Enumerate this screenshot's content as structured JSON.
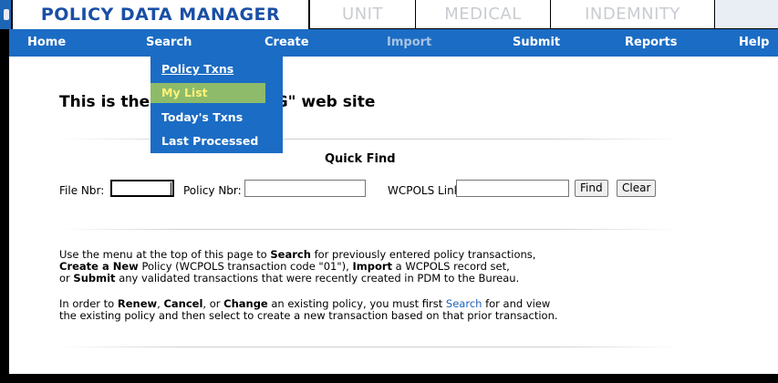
{
  "tabs": {
    "active": "POLICY DATA MANAGER",
    "unit": "UNIT",
    "medical": "MEDICAL",
    "indemnity": "INDEMNITY"
  },
  "menu": {
    "home": "Home",
    "search": "Search",
    "create": "Create",
    "import": "Import",
    "submit": "Submit",
    "reports": "Reports",
    "help": "Help"
  },
  "search_dropdown": {
    "items": [
      "Policy Txns",
      "My List",
      "Today's Txns",
      "Last Processed"
    ],
    "hovered": "My List"
  },
  "heading": {
    "visible_left": "This is the",
    "visible_right": "GING\" web site"
  },
  "quick_find": {
    "title": "Quick Find",
    "file_label": "File Nbr:",
    "policy_label": "Policy Nbr:",
    "wcpols_label": "WCPOLS Link:",
    "file_value": "",
    "policy_value": "",
    "wcpols_value": "",
    "find_button": "Find",
    "clear_button": "Clear"
  },
  "instructions": {
    "p1_line1_a": "Use the menu at the top of this page to ",
    "p1_line1_b": "Search",
    "p1_line1_c": " for previously entered policy transactions,",
    "p1_line2_a": "Create a New",
    "p1_line2_b": " Policy (WCPOLS transaction code \"01\"), ",
    "p1_line2_c": "Import",
    "p1_line2_d": " a WCPOLS record set,",
    "p1_line3_a": "or ",
    "p1_line3_b": "Submit",
    "p1_line3_c": " any validated transactions that were recently created in PDM to the Bureau.",
    "p2_line1_a": "In order to ",
    "p2_line1_b": "Renew",
    "p2_line1_c": ", ",
    "p2_line1_d": "Cancel",
    "p2_line1_e": ", or ",
    "p2_line1_f": "Change",
    "p2_line1_g": " an existing policy, you must first ",
    "p2_line1_link": "Search",
    "p2_line1_h": " for and view",
    "p2_line2": "the existing policy and then select to create a new transaction based on that prior transaction."
  },
  "colors": {
    "menu_bg": "#1b6cc4",
    "hover_bg": "#8dbb6a",
    "hover_text": "#fff27a",
    "active_tab_text": "#1a4fa6",
    "link": "#1f63b8"
  }
}
